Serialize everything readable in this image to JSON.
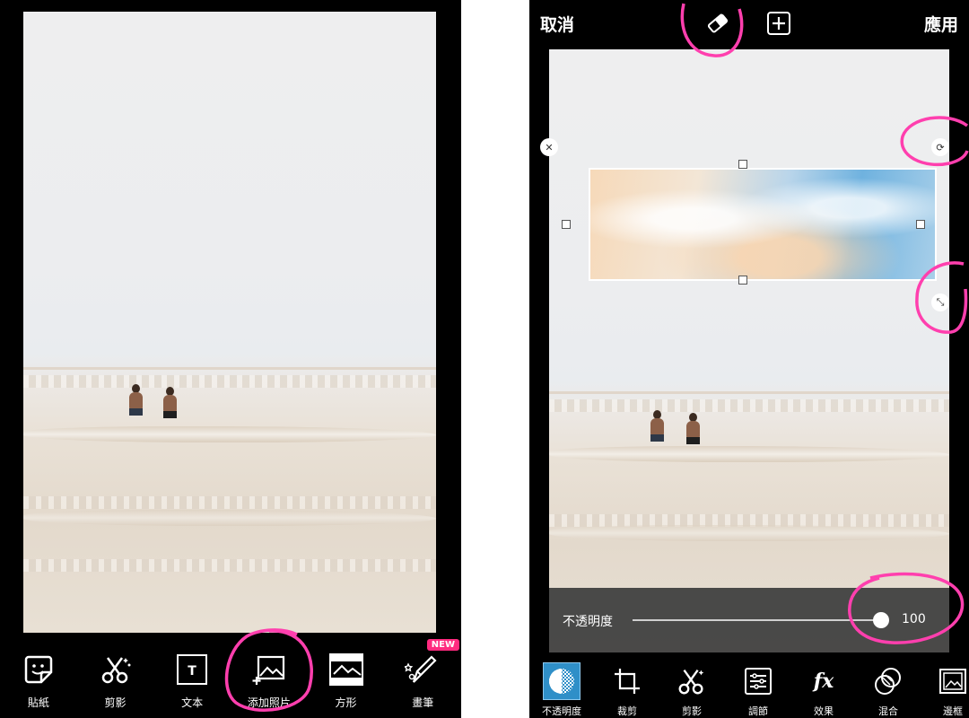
{
  "left_screen": {
    "toolbar": {
      "items": [
        {
          "label": "貼紙",
          "icon": "sticker-icon"
        },
        {
          "label": "剪影",
          "icon": "cutout-scissors-icon"
        },
        {
          "label": "文本",
          "icon": "text-icon"
        },
        {
          "label": "添加照片",
          "icon": "add-photo-icon"
        },
        {
          "label": "方形",
          "icon": "square-fit-icon"
        },
        {
          "label": "畫筆",
          "icon": "brush-icon",
          "badge": "NEW"
        }
      ]
    }
  },
  "right_screen": {
    "topbar": {
      "cancel_label": "取消",
      "apply_label": "應用",
      "eraser_icon": "eraser-icon",
      "add_icon": "plus-square-icon"
    },
    "overlay_controls": {
      "close_icon": "close-icon",
      "rotate_icon": "rotate-icon",
      "resize_icon": "resize-icon"
    },
    "opacity_panel": {
      "label": "不透明度",
      "value": 100,
      "value_text": "100"
    },
    "toolbar": {
      "items": [
        {
          "label": "不透明度",
          "icon": "opacity-icon",
          "active": true
        },
        {
          "label": "裁剪",
          "icon": "crop-icon"
        },
        {
          "label": "剪影",
          "icon": "cutout-scissors-icon"
        },
        {
          "label": "調節",
          "icon": "adjust-icon"
        },
        {
          "label": "效果",
          "icon": "fx-icon"
        },
        {
          "label": "混合",
          "icon": "blend-icon"
        },
        {
          "label": "邊框",
          "icon": "border-icon"
        }
      ]
    }
  },
  "colors": {
    "highlight": "#ff3fae",
    "new_badge": "#ff2a7f",
    "active_tool": "#2f8fc8"
  }
}
